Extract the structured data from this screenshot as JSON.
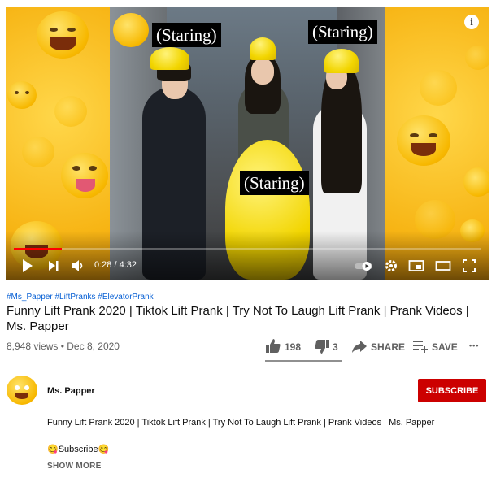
{
  "player": {
    "captions": [
      "(Staring)",
      "(Staring)",
      "(Staring)"
    ],
    "info_symbol": "i",
    "time_current": "0:28",
    "time_total": "4:32",
    "progress_fraction": 0.103
  },
  "video": {
    "hashtags": "#Ms_Papper #LiftPranks #ElevatorPrank",
    "title": "Funny Lift Prank 2020 | Tiktok Lift Prank | Try Not To Laugh Lift Prank | Prank Videos | Ms. Papper",
    "views": "8,948 views",
    "separator": "•",
    "date": "Dec 8, 2020"
  },
  "actions": {
    "likes": "198",
    "dislikes": "3",
    "share": "SHARE",
    "save": "SAVE",
    "more": "•••"
  },
  "channel": {
    "name": "Ms. Papper",
    "subscribe": "SUBSCRIBE"
  },
  "description": {
    "text": "Funny Lift Prank 2020 | Tiktok Lift Prank | Try Not To Laugh Lift Prank | Prank Videos | Ms. Papper",
    "subscribe_line": "😋Subscribe😋",
    "show_more": "SHOW MORE"
  },
  "colors": {
    "accent_red": "#cc0000",
    "progress_red": "#ff0000",
    "link_blue": "#065fd4"
  }
}
